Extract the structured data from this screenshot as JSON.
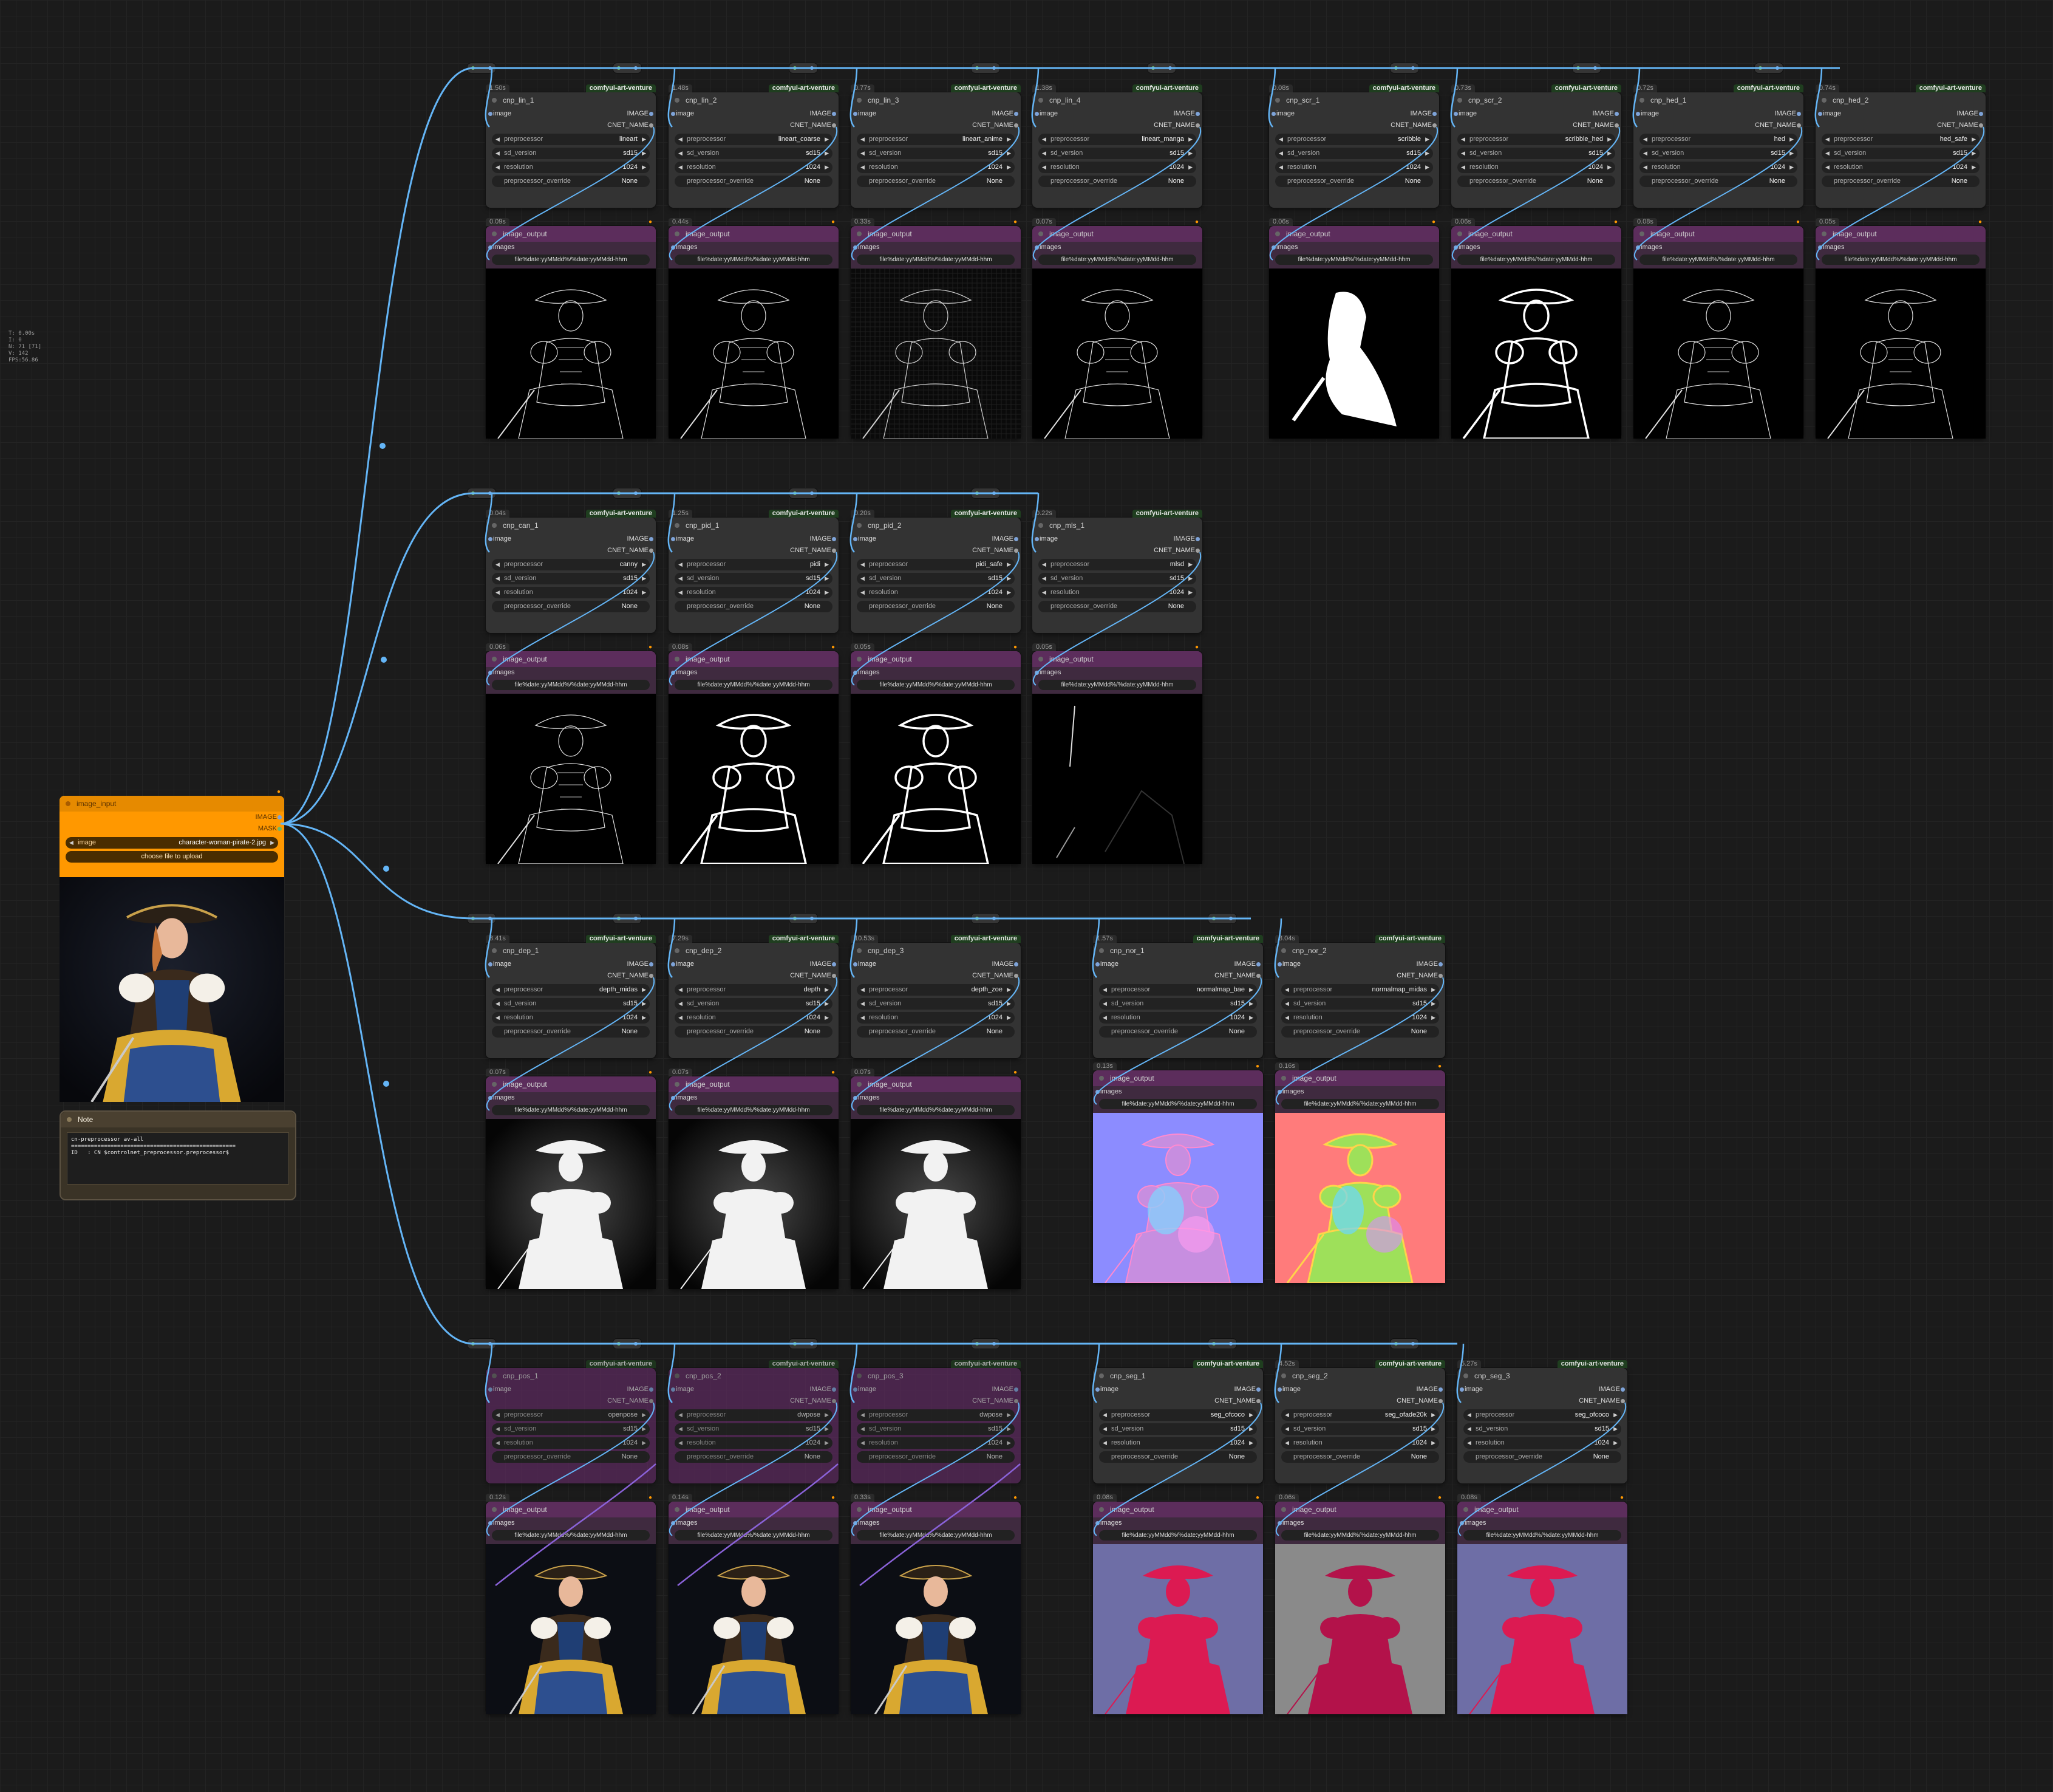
{
  "stats": {
    "lines": [
      "T: 0.00s",
      "I: 0",
      "N: 71 [71]",
      "V: 142",
      "FPS:56.86"
    ]
  },
  "common": {
    "pack": "comfyui-art-venture",
    "out_title": "image_output",
    "out_input": "images",
    "file_prefix": "file%date:yyMMdd%/%date:yyMMdd-hhm",
    "label_image": "image",
    "label_IMAGE": "IMAGE",
    "label_cnet": "CNET_NAME",
    "w_pre": "preprocessor",
    "w_sd": "sd_version",
    "w_res": "resolution",
    "w_ovr": "preprocessor_override",
    "sd_val": "sd15",
    "res_val": "1024",
    "ovr_val": "None"
  },
  "loader": {
    "title": "image_input",
    "out1": "IMAGE",
    "out2": "MASK",
    "widget_label": "image",
    "widget_value": "character-woman-pirate-2.jpg",
    "upload_label": "choose file to upload"
  },
  "note": {
    "title": "Note",
    "text": "cn-preprocessor av-all\n==================================================\nID   : CN $controlnet_preprocessor.preprocessor$"
  },
  "nodes": [
    {
      "title": "cnp_lin_1",
      "preprocessor": "lineart",
      "time": "1.50s",
      "out_time": "0.09s",
      "img": "line",
      "bypass": false
    },
    {
      "title": "cnp_lin_2",
      "preprocessor": "lineart_coarse",
      "time": "1.48s",
      "out_time": "0.44s",
      "img": "line",
      "bypass": false
    },
    {
      "title": "cnp_lin_3",
      "preprocessor": "lineart_anime",
      "time": "0.77s",
      "out_time": "0.33s",
      "img": "line_grid",
      "bypass": false
    },
    {
      "title": "cnp_lin_4",
      "preprocessor": "lineart_manga",
      "time": "1.38s",
      "out_time": "0.07s",
      "img": "line",
      "bypass": false
    },
    {
      "title": "cnp_scr_1",
      "preprocessor": "scribble",
      "time": "0.08s",
      "out_time": "0.06s",
      "img": "blob",
      "bypass": false
    },
    {
      "title": "cnp_scr_2",
      "preprocessor": "scribble_hed",
      "time": "0.73s",
      "out_time": "0.06s",
      "img": "scribble",
      "bypass": false
    },
    {
      "title": "cnp_hed_1",
      "preprocessor": "hed",
      "time": "0.72s",
      "out_time": "0.08s",
      "img": "line",
      "bypass": false
    },
    {
      "title": "cnp_hed_2",
      "preprocessor": "hed_safe",
      "time": "0.74s",
      "out_time": "0.05s",
      "img": "line",
      "bypass": false
    },
    {
      "title": "cnp_can_1",
      "preprocessor": "canny",
      "time": "0.04s",
      "out_time": "0.06s",
      "img": "line",
      "bypass": false
    },
    {
      "title": "cnp_pid_1",
      "preprocessor": "pidi",
      "time": "1.25s",
      "out_time": "0.08s",
      "img": "scribble",
      "bypass": false
    },
    {
      "title": "cnp_pid_2",
      "preprocessor": "pidi_safe",
      "time": "0.20s",
      "out_time": "0.05s",
      "img": "scribble",
      "bypass": false
    },
    {
      "title": "cnp_mls_1",
      "preprocessor": "mlsd",
      "time": "0.22s",
      "out_time": "0.05s",
      "img": "mlsd",
      "bypass": false
    },
    {
      "title": "cnp_dep_1",
      "preprocessor": "depth_midas",
      "time": "8.41s",
      "out_time": "0.07s",
      "img": "depth",
      "bypass": false
    },
    {
      "title": "cnp_dep_2",
      "preprocessor": "depth",
      "time": "7.29s",
      "out_time": "0.07s",
      "img": "depth",
      "bypass": false
    },
    {
      "title": "cnp_dep_3",
      "preprocessor": "depth_zoe",
      "time": "10.53s",
      "out_time": "0.07s",
      "img": "depth",
      "bypass": false
    },
    {
      "title": "cnp_nor_1",
      "preprocessor": "normalmap_bae",
      "time": "1.57s",
      "out_time": "0.13s",
      "img": "normal_bae",
      "bypass": false
    },
    {
      "title": "cnp_nor_2",
      "preprocessor": "normalmap_midas",
      "time": "3.04s",
      "out_time": "0.16s",
      "img": "normal_midas",
      "bypass": false
    },
    {
      "title": "cnp_pos_1",
      "preprocessor": "openpose",
      "time": "",
      "out_time": "0.12s",
      "img": "photo",
      "bypass": true
    },
    {
      "title": "cnp_pos_2",
      "preprocessor": "dwpose",
      "time": "",
      "out_time": "0.14s",
      "img": "photo",
      "bypass": true
    },
    {
      "title": "cnp_pos_3",
      "preprocessor": "dwpose",
      "time": "",
      "out_time": "0.33s",
      "img": "photo",
      "bypass": true
    },
    {
      "title": "cnp_seg_1",
      "preprocessor": "seg_ofcoco",
      "time": "",
      "out_time": "0.08s",
      "img": "seg_blue",
      "bypass": false
    },
    {
      "title": "cnp_seg_2",
      "preprocessor": "seg_ofade20k",
      "time": "4.52s",
      "out_time": "0.06s",
      "img": "seg_gray",
      "bypass": false
    },
    {
      "title": "cnp_seg_3",
      "preprocessor": "seg_ofcoco",
      "time": "5.27s",
      "out_time": "0.08s",
      "img": "seg_blue",
      "bypass": false
    }
  ]
}
